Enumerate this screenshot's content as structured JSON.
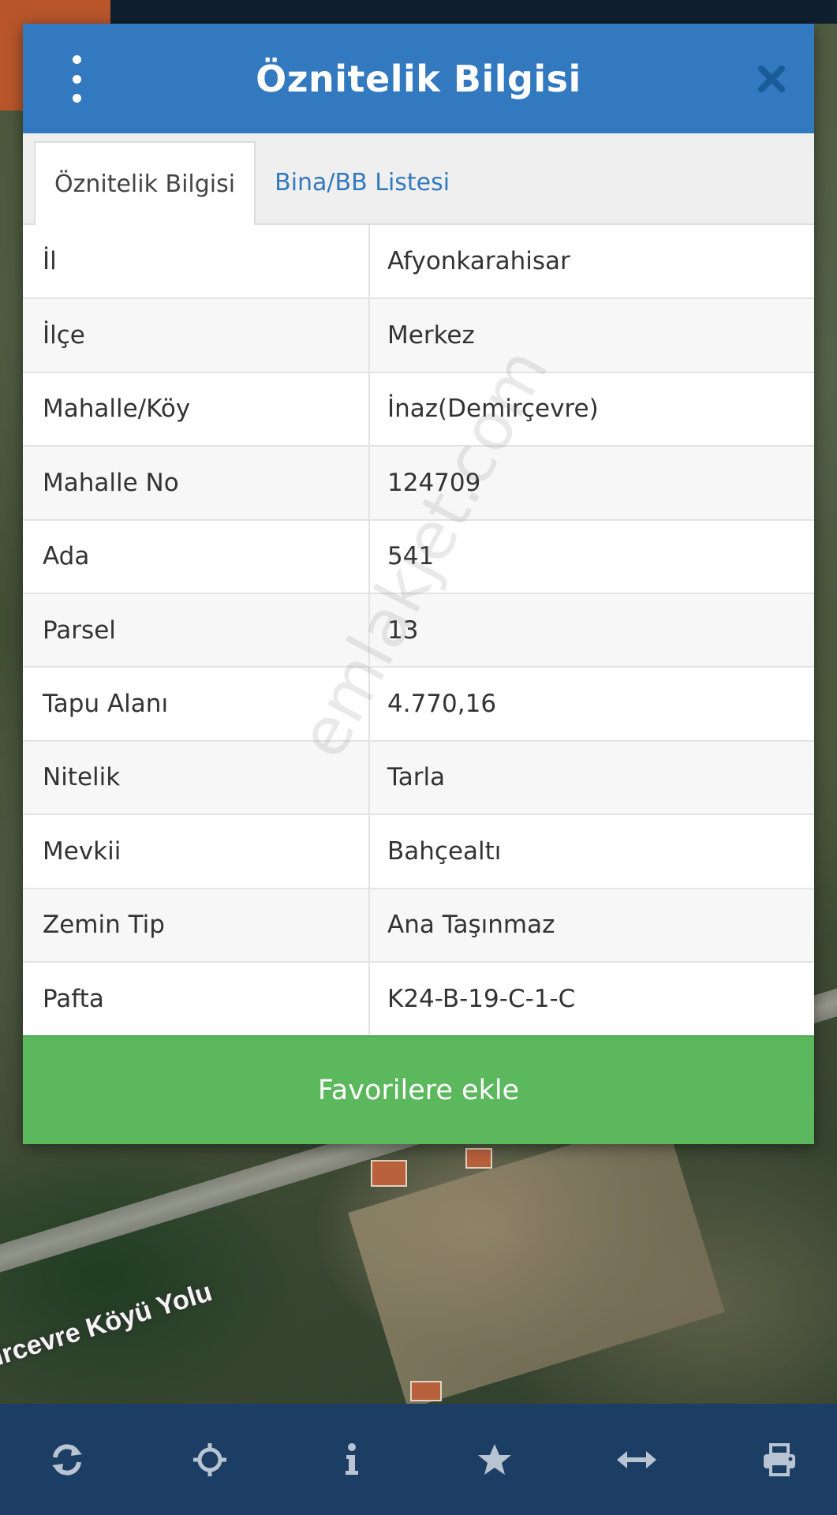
{
  "map": {
    "road_label": "ircevre Köyü Yolu"
  },
  "dialog": {
    "title": "Öznitelik Bilgisi",
    "tabs": [
      {
        "label": "Öznitelik Bilgisi",
        "active": true
      },
      {
        "label": "Bina/BB Listesi",
        "active": false
      }
    ],
    "rows": [
      {
        "key": "İl",
        "value": "Afyonkarahisar"
      },
      {
        "key": "İlçe",
        "value": "Merkez"
      },
      {
        "key": "Mahalle/Köy",
        "value": "İnaz(Demirçevre)"
      },
      {
        "key": "Mahalle No",
        "value": "124709"
      },
      {
        "key": "Ada",
        "value": "541"
      },
      {
        "key": "Parsel",
        "value": "13"
      },
      {
        "key": "Tapu Alanı",
        "value": "4.770,16"
      },
      {
        "key": "Nitelik",
        "value": "Tarla"
      },
      {
        "key": "Mevkii",
        "value": "Bahçealtı"
      },
      {
        "key": "Zemin Tip",
        "value": "Ana Taşınmaz"
      },
      {
        "key": "Pafta",
        "value": "K24-B-19-C-1-C"
      }
    ],
    "favorite_button": "Favorilere ekle",
    "watermark": "emlakjet.com"
  },
  "toolbar": {
    "icons": [
      "refresh-icon",
      "locate-icon",
      "info-icon",
      "star-icon",
      "measure-icon",
      "print-icon"
    ]
  },
  "colors": {
    "header_blue": "#3379bf",
    "tab_link_blue": "#3379bf",
    "favorite_green": "#5cb85c",
    "toolbar_navy": "#1c3d64",
    "toolbar_icon": "#b8c4d2"
  }
}
